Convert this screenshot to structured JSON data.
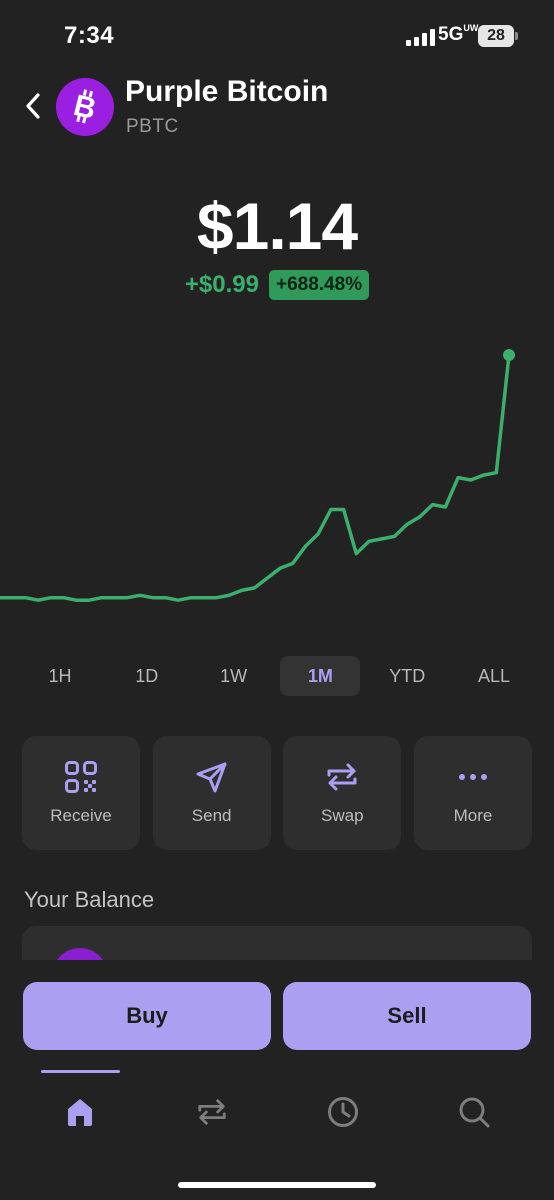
{
  "status_bar": {
    "time": "7:34",
    "network": "5G",
    "network_sup": "UW",
    "battery": "28"
  },
  "header": {
    "back_icon": "chevron-left-icon",
    "coin_name": "Purple Bitcoin",
    "ticker": "PBTC",
    "logo_icon": "bitcoin-icon",
    "logo_color": "#9b1fe0"
  },
  "price": {
    "value": "$1.14",
    "change_abs": "+$0.99",
    "change_pct": "+688.48%",
    "change_color": "#3bb06c"
  },
  "chart_data": {
    "type": "line",
    "title": "",
    "xlabel": "",
    "ylabel": "",
    "ylim": [
      0.1,
      1.14
    ],
    "line_color": "#3bb06c",
    "grid": false,
    "series": [
      {
        "values": [
          0.15,
          0.15,
          0.15,
          0.14,
          0.15,
          0.15,
          0.14,
          0.14,
          0.15,
          0.15,
          0.15,
          0.16,
          0.15,
          0.15,
          0.14,
          0.15,
          0.15,
          0.15,
          0.16,
          0.18,
          0.19,
          0.23,
          0.27,
          0.29,
          0.36,
          0.41,
          0.51,
          0.51,
          0.33,
          0.38,
          0.39,
          0.4,
          0.45,
          0.48,
          0.53,
          0.52,
          0.64,
          0.63,
          0.65,
          0.66,
          1.14
        ]
      }
    ]
  },
  "ranges": {
    "items": [
      "1H",
      "1D",
      "1W",
      "1M",
      "YTD",
      "ALL"
    ],
    "selected": "1M"
  },
  "actions": [
    {
      "label": "Receive",
      "icon": "qr-code-icon"
    },
    {
      "label": "Send",
      "icon": "send-icon"
    },
    {
      "label": "Swap",
      "icon": "swap-icon"
    },
    {
      "label": "More",
      "icon": "more-icon"
    }
  ],
  "balance": {
    "title": "Your Balance"
  },
  "trade": {
    "buy_label": "Buy",
    "sell_label": "Sell"
  },
  "tabbar": {
    "items": [
      "home-icon",
      "swap-icon",
      "clock-icon",
      "search-icon"
    ],
    "active": "home-icon",
    "accent": "#ab9ff2"
  }
}
